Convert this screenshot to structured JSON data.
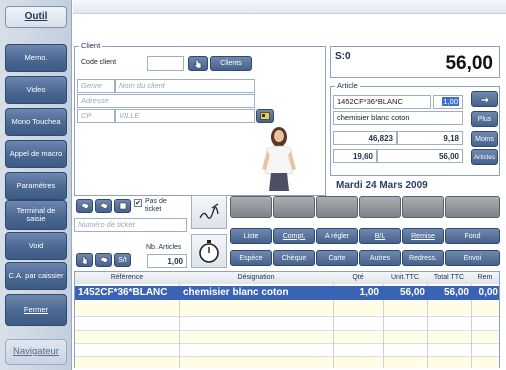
{
  "sidebar": {
    "items": [
      {
        "label": "Outil"
      },
      {
        "label": "Memo."
      },
      {
        "label": "Video"
      },
      {
        "label": "Mono Touchea"
      },
      {
        "label": "Appel de macro"
      },
      {
        "label": "Paramètres"
      },
      {
        "label": "Terminal de saisie"
      },
      {
        "label": "Void"
      },
      {
        "label": "C.A. par caissier"
      },
      {
        "label": "Fermer"
      },
      {
        "label": "Navigateur"
      }
    ]
  },
  "client": {
    "legend": "Client",
    "code_label": "Code client",
    "code_value": "",
    "clients_button": "Clients",
    "genre_placeholder": "Genre",
    "nom_placeholder": "Nom du client",
    "adresse_placeholder": "Adresse",
    "cp_placeholder": "CP",
    "ville_placeholder": "VILLE"
  },
  "summary": {
    "status": "S:0",
    "total": "56,00"
  },
  "article": {
    "legend": "Article",
    "reference": "1452CF*36*BLANC",
    "quantity": "1,00",
    "designation": "chemisier blanc coton",
    "value1": "46,823",
    "value2": "9,18",
    "value3": "19,60",
    "value4": "56,00",
    "plus_button": "Plus",
    "moins_button": "Moins",
    "articles_button": "Articles"
  },
  "date": "Mardi 24 Mars 2009",
  "ticket": {
    "pas_de_ticket": "Pas de ticket",
    "numero_placeholder": "Numéro de ticket",
    "nb_articles_label": "Nb. Articles",
    "nb_articles_value": "1,00",
    "st_label": "S/t"
  },
  "actions": {
    "row1": [
      "Liste",
      "Compt.",
      "A régler",
      "B/L",
      "Remise",
      "Fond"
    ],
    "row2": [
      "Espèce",
      "Chèque",
      "Carte",
      "Autres",
      "Redress.",
      "Envoi"
    ]
  },
  "table": {
    "columns": [
      "Référence",
      "Désignation",
      "Qté",
      "Unit.TTC",
      "Total TTC",
      "Rem"
    ],
    "rows": [
      {
        "reference": "1452CF*36*BLANC",
        "designation": "chemisier blanc coton",
        "qte": "1,00",
        "unit": "56,00",
        "total": "56,00",
        "rem": "0,00"
      }
    ]
  }
}
